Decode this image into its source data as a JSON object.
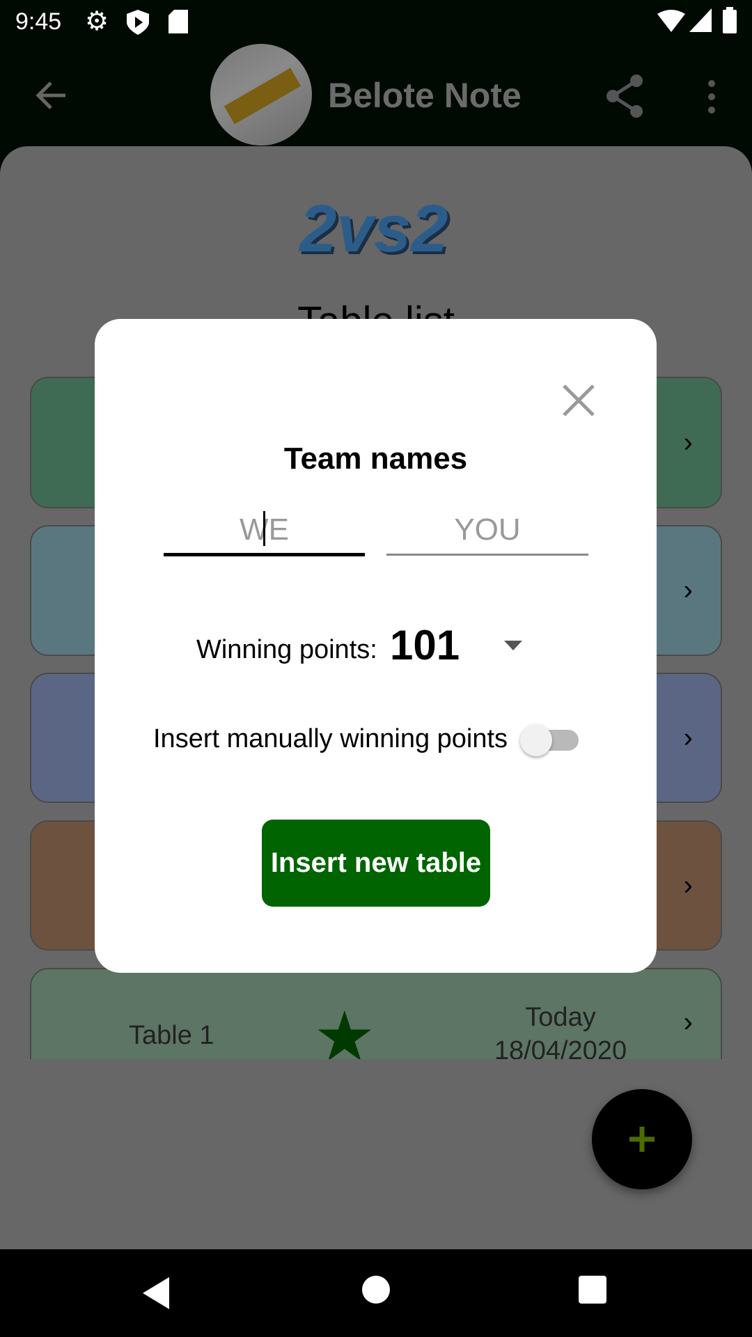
{
  "status_bar": {
    "time": "9:45",
    "icons": [
      "gear-icon",
      "shield-play-icon",
      "sd-card-icon",
      "wifi-icon",
      "signal-icon",
      "battery-icon"
    ]
  },
  "app_bar": {
    "title": "Belote Note",
    "icons": [
      "back-arrow-icon",
      "share-icon",
      "more-vert-icon"
    ]
  },
  "content": {
    "logo_text": "2vs2",
    "list_title": "Table list",
    "cards": [
      {
        "color": "#3f6b55"
      },
      {
        "color": "#5a7780"
      },
      {
        "color": "#5a6684"
      },
      {
        "color": "#6e5240"
      },
      {
        "color": "#5d7564",
        "name": "Table 1",
        "day": "Today",
        "date": "18/04/2020"
      }
    ]
  },
  "dialog": {
    "title": "Team names",
    "team1_placeholder": "WE",
    "team2_placeholder": "YOU",
    "winning_label": "Winning points:",
    "winning_value": "101",
    "manual_label": "Insert manually winning points",
    "manual_toggle_on": false,
    "button_label": "Insert new table",
    "button_color": "#006400"
  },
  "fab": {
    "icon": "plus-icon"
  }
}
